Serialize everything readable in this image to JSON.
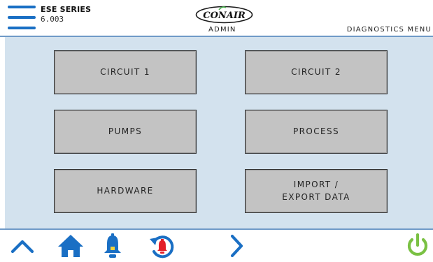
{
  "header": {
    "series": "ESE SERIES",
    "version": "6.003",
    "logo_text": "CONAIR",
    "role": "ADMIN",
    "screen_title": "DIAGNOSTICS MENU"
  },
  "menu": {
    "items": [
      {
        "label": "CIRCUIT 1"
      },
      {
        "label": "CIRCUIT 2"
      },
      {
        "label": "PUMPS"
      },
      {
        "label": "PROCESS"
      },
      {
        "label": "HARDWARE"
      },
      {
        "label": "IMPORT /\nEXPORT DATA"
      }
    ]
  },
  "footer": {
    "icons": [
      "chevron-up-icon",
      "home-icon",
      "alarm-bell-icon",
      "alarm-history-icon",
      "chevron-right-icon",
      "power-icon"
    ]
  },
  "colors": {
    "accent_blue": "#1a6fc4",
    "alarm_red": "#e3202a",
    "power_green": "#7ac143",
    "panel_bg": "#d3e2ee",
    "tile_bg": "#c3c3c3"
  }
}
